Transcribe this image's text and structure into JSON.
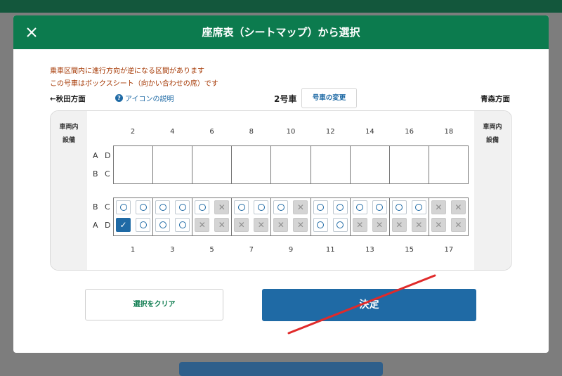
{
  "modal": {
    "title": "座席表（シートマップ）から選択",
    "close_icon": "close-icon",
    "notice_line1": "乗車区間内に進行方向が逆になる区間があります",
    "notice_line2": "この号車はボックスシート（向かい合わせの席）です",
    "direction_left": "←秋田方面",
    "direction_right": "青森方面",
    "icon_help_label": "アイコンの説明",
    "icon_help_glyph": "?",
    "car_number": "2号車",
    "car_change_label": "号車の変更",
    "facility_label_line1": "車両内",
    "facility_label_line2": "設備",
    "top_row_labels": [
      "A D",
      "B C"
    ],
    "bottom_row_labels": [
      "B C",
      "A D"
    ],
    "top_numbers": [
      "2",
      "4",
      "6",
      "8",
      "10",
      "12",
      "14",
      "16",
      "18"
    ],
    "bottom_numbers": [
      "1",
      "3",
      "5",
      "7",
      "9",
      "11",
      "13",
      "15",
      "17"
    ],
    "clear_button_label": "選択をクリア",
    "decide_button_label": "決定",
    "colors": {
      "header": "#0c7b4e",
      "primary_button": "#1f6aa5",
      "notice_text": "#a63a06",
      "annotation_line": "#e02a2a"
    }
  },
  "seats": {
    "legend": {
      "available": "○",
      "unavailable": "✕",
      "selected": "✓"
    },
    "row_bc": [
      [
        "available",
        "available"
      ],
      [
        "available",
        "available"
      ],
      [
        "available",
        "unavailable"
      ],
      [
        "available",
        "available"
      ],
      [
        "available",
        "unavailable"
      ],
      [
        "available",
        "available"
      ],
      [
        "available",
        "available"
      ],
      [
        "available",
        "available"
      ],
      [
        "unavailable",
        "unavailable"
      ]
    ],
    "row_ad": [
      [
        "selected",
        "available"
      ],
      [
        "available",
        "available"
      ],
      [
        "unavailable",
        "unavailable"
      ],
      [
        "unavailable",
        "unavailable"
      ],
      [
        "unavailable",
        "unavailable"
      ],
      [
        "available",
        "available"
      ],
      [
        "unavailable",
        "unavailable"
      ],
      [
        "unavailable",
        "unavailable"
      ],
      [
        "unavailable",
        "unavailable"
      ]
    ]
  }
}
